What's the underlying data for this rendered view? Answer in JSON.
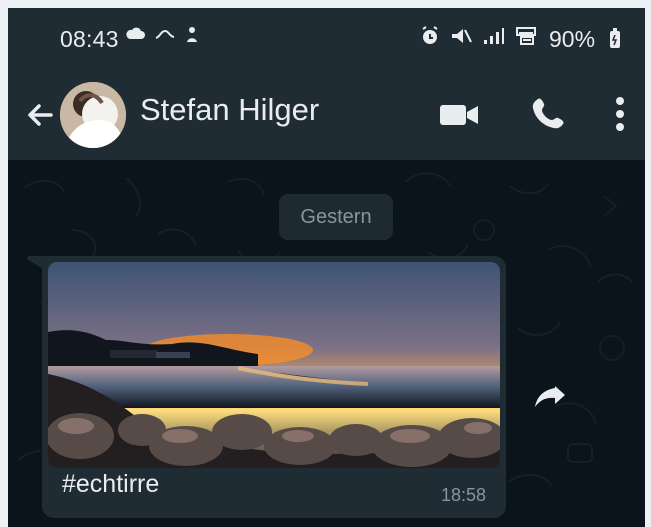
{
  "status_bar": {
    "time": "08:43",
    "battery": "90%",
    "left_icons": [
      "cloud-icon",
      "signal-path-icon",
      "person-icon"
    ],
    "right_icons": [
      "alarm-icon",
      "mute-icon",
      "signal-icon",
      "network-icon"
    ]
  },
  "header": {
    "contact_name": "Stefan Hilger",
    "icons": [
      "back-arrow-icon",
      "avatar",
      "video-call-icon",
      "phone-call-icon",
      "more-options-icon"
    ]
  },
  "chat": {
    "date_label": "Gestern",
    "message": {
      "caption": "#echtirre",
      "time": "18:58",
      "image_semantic": "sunset-coast-photo"
    },
    "forward_icon": "forward-arrow-icon"
  },
  "colors": {
    "header_bg": "#1f2c33",
    "chat_bg": "#0b141a",
    "bubble_bg": "#202c33",
    "text_primary": "#e9edef",
    "text_secondary": "#8696a0"
  }
}
